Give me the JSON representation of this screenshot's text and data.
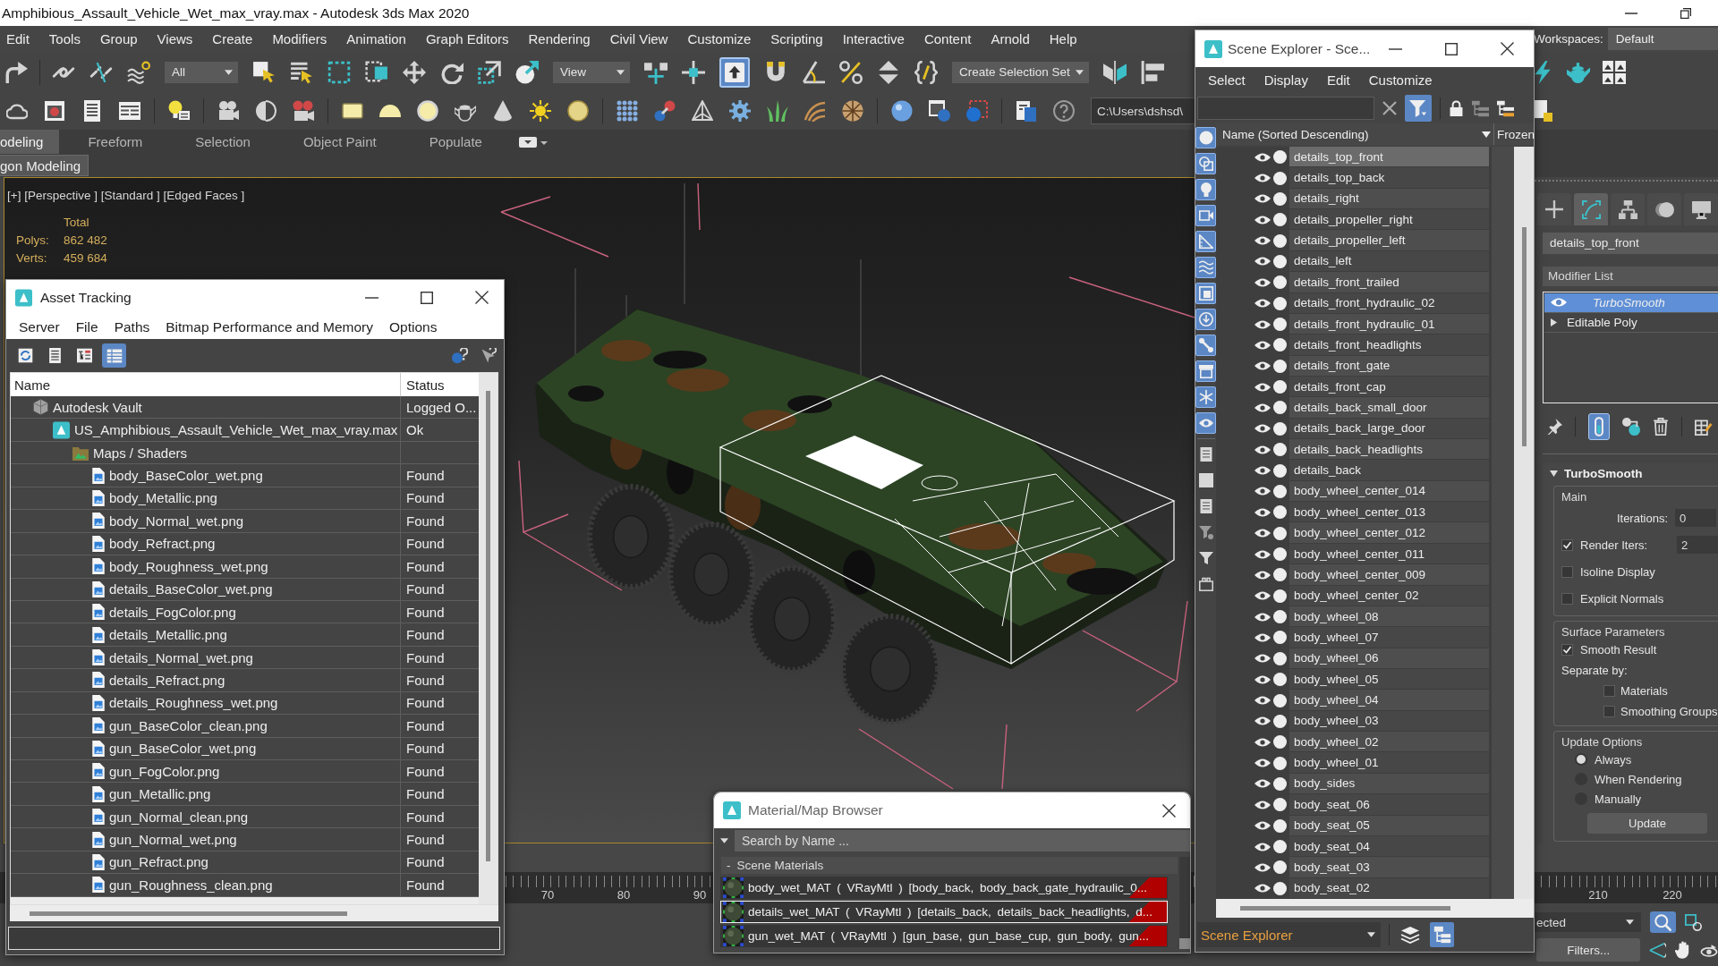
{
  "window": {
    "title": "Amphibious_Assault_Vehicle_Wet_max_vray.max - Autodesk 3ds Max 2020"
  },
  "menu_bar": [
    "Edit",
    "Tools",
    "Group",
    "Views",
    "Create",
    "Modifiers",
    "Animation",
    "Graph Editors",
    "Rendering",
    "Civil View",
    "Customize",
    "Scripting",
    "Interactive",
    "Content",
    "Arnold",
    "Help"
  ],
  "workspaces": {
    "label": "Workspaces:",
    "value": "Default"
  },
  "main_toolbar": {
    "selection_filter": "All",
    "reference_coordinate_system": "View",
    "override_toggle_on": true,
    "named_selection_set": "Create Selection Set"
  },
  "secondary_toolbar": {
    "project_path": "C:\\Users\\dshsd\\"
  },
  "ribbon": {
    "tabs": [
      {
        "label": "odeling",
        "selected": true
      },
      {
        "label": "Freeform",
        "selected": false
      },
      {
        "label": "Selection",
        "selected": false
      },
      {
        "label": "Object Paint",
        "selected": false
      },
      {
        "label": "Populate",
        "selected": false
      }
    ],
    "panel_title": "gon Modeling"
  },
  "viewport": {
    "label": "[+] [Perspective ] [Standard ] [Edged Faces ]",
    "stats_header": "Total",
    "stats": [
      {
        "label": "Polys:",
        "value": "862 482"
      },
      {
        "label": "Verts:",
        "value": "459 684"
      }
    ]
  },
  "asset_tracking": {
    "title": "Asset Tracking",
    "menu": [
      "Server",
      "File",
      "Paths",
      "Bitmap Performance and Memory",
      "Options"
    ],
    "view_modes": [
      {
        "selected": false
      },
      {
        "selected": false
      },
      {
        "selected": false
      },
      {
        "selected": true
      }
    ],
    "columns": [
      "Name",
      "Status"
    ],
    "tree": [
      {
        "name": "Autodesk Vault",
        "status": "Logged O...",
        "children": [
          {
            "name": "US_Amphibious_Assault_Vehicle_Wet_max_vray.max",
            "status": "Ok",
            "children": [
              {
                "name": "Maps / Shaders",
                "children": [
                  {
                    "name": "body_BaseColor_wet.png",
                    "status": "Found"
                  },
                  {
                    "name": "body_Metallic.png",
                    "status": "Found"
                  },
                  {
                    "name": "body_Normal_wet.png",
                    "status": "Found"
                  },
                  {
                    "name": "body_Refract.png",
                    "status": "Found"
                  },
                  {
                    "name": "body_Roughness_wet.png",
                    "status": "Found"
                  },
                  {
                    "name": "details_BaseColor_wet.png",
                    "status": "Found"
                  },
                  {
                    "name": "details_FogColor.png",
                    "status": "Found"
                  },
                  {
                    "name": "details_Metallic.png",
                    "status": "Found"
                  },
                  {
                    "name": "details_Normal_wet.png",
                    "status": "Found"
                  },
                  {
                    "name": "details_Refract.png",
                    "status": "Found"
                  },
                  {
                    "name": "details_Roughness_wet.png",
                    "status": "Found"
                  },
                  {
                    "name": "gun_BaseColor_clean.png",
                    "status": "Found"
                  },
                  {
                    "name": "gun_BaseColor_wet.png",
                    "status": "Found"
                  },
                  {
                    "name": "gun_FogColor.png",
                    "status": "Found"
                  },
                  {
                    "name": "gun_Metallic.png",
                    "status": "Found"
                  },
                  {
                    "name": "gun_Normal_clean.png",
                    "status": "Found"
                  },
                  {
                    "name": "gun_Normal_wet.png",
                    "status": "Found"
                  },
                  {
                    "name": "gun_Refract.png",
                    "status": "Found"
                  },
                  {
                    "name": "gun_Roughness_clean.png",
                    "status": "Found"
                  }
                ]
              }
            ]
          }
        ]
      }
    ]
  },
  "material_browser": {
    "title": "Material/Map Browser",
    "search": {
      "placeholder": "Search by Name ..."
    },
    "group": {
      "toggle": "-",
      "label": "Scene Materials"
    },
    "materials": [
      {
        "text": "body_wet_MAT ( VRayMtl ) [body_back, body_back_gate_hydraulic_0...",
        "selected": false
      },
      {
        "text": "details_wet_MAT ( VRayMtl ) [details_back, details_back_headlights, d...",
        "selected": true
      },
      {
        "text": "gun_wet_MAT ( VRayMtl ) [gun_base, gun_base_cup, gun_body, gun...",
        "selected": false
      }
    ]
  },
  "scene_explorer": {
    "title": "Scene Explorer - Sce...",
    "menu": [
      "Select",
      "Display",
      "Edit",
      "Customize"
    ],
    "filter_on": true,
    "type_filters": [
      {
        "on": true
      },
      {
        "on": true
      },
      {
        "on": true
      },
      {
        "on": true
      },
      {
        "on": true
      },
      {
        "on": true
      },
      {
        "on": true
      },
      {
        "on": true
      },
      {
        "on": true
      },
      {
        "on": true
      },
      {
        "on": true
      },
      {
        "on": true
      }
    ],
    "columns": [
      "Name (Sorted Descending)",
      "Frozen"
    ],
    "objects": [
      {
        "name": "details_top_front",
        "selected": true
      },
      {
        "name": "details_top_back",
        "selected": false
      },
      {
        "name": "details_right",
        "selected": false
      },
      {
        "name": "details_propeller_right",
        "selected": false
      },
      {
        "name": "details_propeller_left",
        "selected": false
      },
      {
        "name": "details_left",
        "selected": false
      },
      {
        "name": "details_front_trailed",
        "selected": false
      },
      {
        "name": "details_front_hydraulic_02",
        "selected": false
      },
      {
        "name": "details_front_hydraulic_01",
        "selected": false
      },
      {
        "name": "details_front_headlights",
        "selected": false
      },
      {
        "name": "details_front_gate",
        "selected": false
      },
      {
        "name": "details_front_cap",
        "selected": false
      },
      {
        "name": "details_back_small_door",
        "selected": false
      },
      {
        "name": "details_back_large_door",
        "selected": false
      },
      {
        "name": "details_back_headlights",
        "selected": false
      },
      {
        "name": "details_back",
        "selected": false
      },
      {
        "name": "body_wheel_center_014",
        "selected": false
      },
      {
        "name": "body_wheel_center_013",
        "selected": false
      },
      {
        "name": "body_wheel_center_012",
        "selected": false
      },
      {
        "name": "body_wheel_center_011",
        "selected": false
      },
      {
        "name": "body_wheel_center_009",
        "selected": false
      },
      {
        "name": "body_wheel_center_02",
        "selected": false
      },
      {
        "name": "body_wheel_08",
        "selected": false
      },
      {
        "name": "body_wheel_07",
        "selected": false
      },
      {
        "name": "body_wheel_06",
        "selected": false
      },
      {
        "name": "body_wheel_05",
        "selected": false
      },
      {
        "name": "body_wheel_04",
        "selected": false
      },
      {
        "name": "body_wheel_03",
        "selected": false
      },
      {
        "name": "body_wheel_02",
        "selected": false
      },
      {
        "name": "body_wheel_01",
        "selected": false
      },
      {
        "name": "body_sides",
        "selected": false
      },
      {
        "name": "body_seat_06",
        "selected": false
      },
      {
        "name": "body_seat_05",
        "selected": false
      },
      {
        "name": "body_seat_04",
        "selected": false
      },
      {
        "name": "body_seat_03",
        "selected": false
      },
      {
        "name": "body_seat_02",
        "selected": false
      }
    ],
    "view_selector": "Scene Explorer",
    "bottom_modes": [
      {
        "selected": false
      },
      {
        "selected": true
      }
    ]
  },
  "command_panel": {
    "tabs": [
      {
        "selected": false
      },
      {
        "selected": true
      },
      {
        "selected": false
      },
      {
        "selected": false
      },
      {
        "selected": false
      }
    ],
    "object_name": "details_top_front",
    "modifier_list": "Modifier List",
    "stack": [
      {
        "name": "TurboSmooth",
        "kind": "modifier",
        "selected": true
      },
      {
        "name": "Editable Poly",
        "kind": "base",
        "selected": false
      }
    ],
    "show_end_result_on": true,
    "rollout": {
      "title": "TurboSmooth",
      "expanded": true,
      "groups": [
        {
          "label": "Main",
          "controls": [
            {
              "kind": "spinner",
              "label": "Iterations:",
              "value": "0"
            },
            {
              "kind": "check_spinner",
              "label": "Render Iters:",
              "checked": true,
              "value": "2"
            },
            {
              "kind": "checkbox",
              "label": "Isoline Display",
              "checked": false
            },
            {
              "kind": "checkbox",
              "label": "Explicit Normals",
              "checked": false
            }
          ]
        },
        {
          "label": "Surface Parameters",
          "controls": [
            {
              "kind": "checkbox",
              "label": "Smooth Result",
              "checked": true
            },
            {
              "kind": "text",
              "label": "Separate by:"
            },
            {
              "kind": "sub_checkbox",
              "label": "Materials",
              "checked": false
            },
            {
              "kind": "sub_checkbox",
              "label": "Smoothing Groups",
              "checked": false
            }
          ]
        },
        {
          "label": "Update Options",
          "controls": [
            {
              "kind": "radio",
              "label": "Always",
              "selected": true
            },
            {
              "kind": "radio",
              "label": "When Rendering",
              "selected": false
            },
            {
              "kind": "radio",
              "label": "Manually",
              "selected": false
            },
            {
              "kind": "button",
              "label": "Update"
            }
          ]
        }
      ]
    }
  },
  "timeline": {
    "left_labels": [
      "70",
      "80",
      "90"
    ],
    "right_labels": [
      "210",
      "220"
    ]
  },
  "status_bar": {
    "selection_dropdown": "ected",
    "zoom_on": true,
    "filters_button": "Filters..."
  }
}
